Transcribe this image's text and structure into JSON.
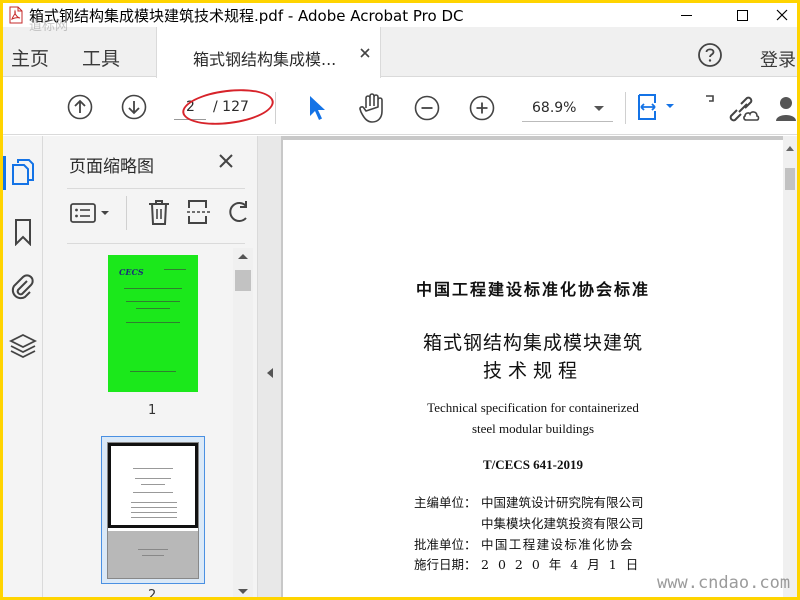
{
  "window": {
    "title": "箱式钢结构集成模块建筑技术规程.pdf - Adobe Acrobat Pro DC"
  },
  "tabs": {
    "home": "主页",
    "tools": "工具",
    "document": "箱式钢结构集成模...",
    "signin": "登录"
  },
  "toolbar": {
    "page_current": "2",
    "page_total": "/ 127",
    "zoom": "68.9%"
  },
  "panel": {
    "title": "页面缩略图",
    "thumbnails": [
      {
        "label": "1"
      },
      {
        "label": "2"
      }
    ]
  },
  "document": {
    "org": "中国工程建设标准化协会标准",
    "title_line1": "箱式钢结构集成模块建筑",
    "title_line2": "技术规程",
    "english_line1": "Technical specification for containerized",
    "english_line2": "steel modular buildings",
    "code": "T/CECS 641-2019",
    "chief_editor_label": "主编单位：",
    "chief_editor_1": "中国建筑设计研究院有限公司",
    "chief_editor_2": "中集模块化建筑投资有限公司",
    "approver_label": "批准单位：",
    "approver": "中国工程建设标准化协会",
    "effective_label": "施行日期：",
    "effective_date": "2020年4月1日"
  },
  "watermarks": {
    "bottom_right": "www.cndao.com",
    "top_left": "道标网"
  },
  "thumb1_logo": "CECS",
  "colors": {
    "accent": "#1473e6",
    "thumbnail_cover": "#1be81b",
    "annotation": "#d7232a",
    "frame": "#ffd400"
  }
}
